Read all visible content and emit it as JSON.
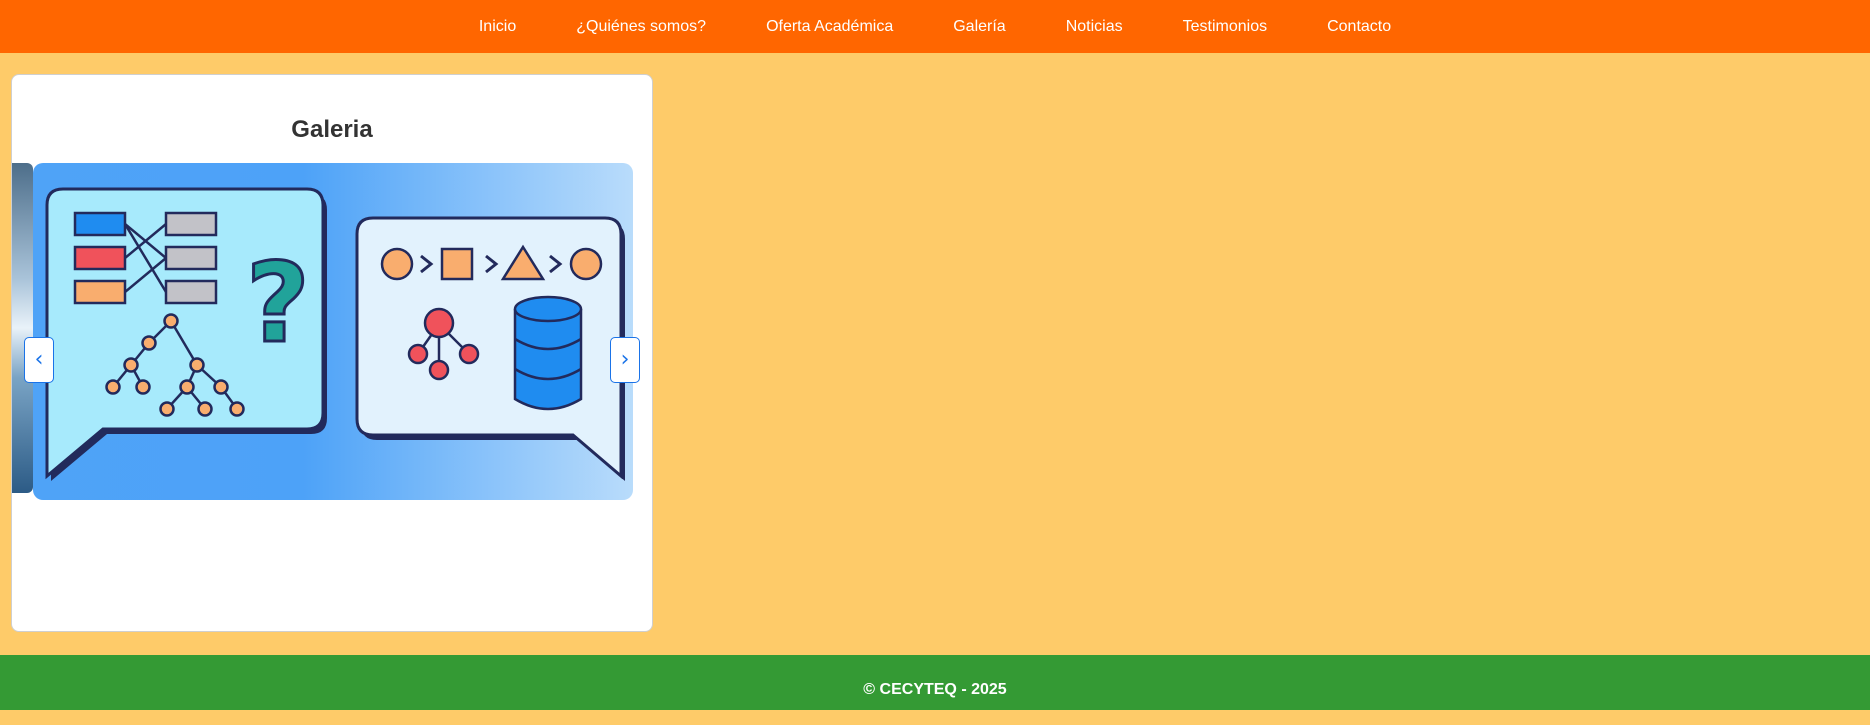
{
  "nav": {
    "items": [
      {
        "label": "Inicio"
      },
      {
        "label": "¿Quiénes somos?"
      },
      {
        "label": "Oferta Académica"
      },
      {
        "label": "Galería"
      },
      {
        "label": "Noticias"
      },
      {
        "label": "Testimonios"
      },
      {
        "label": "Contacto"
      }
    ]
  },
  "gallery": {
    "title": "Galeria",
    "prev_label": "‹",
    "next_label": "›"
  },
  "footer": {
    "text": "© CECYTEQ - 2025"
  },
  "colors": {
    "nav_bg": "#ff6600",
    "page_bg": "#fecb69",
    "footer_bg": "#349a34",
    "carousel_control": "#1a73e8"
  }
}
